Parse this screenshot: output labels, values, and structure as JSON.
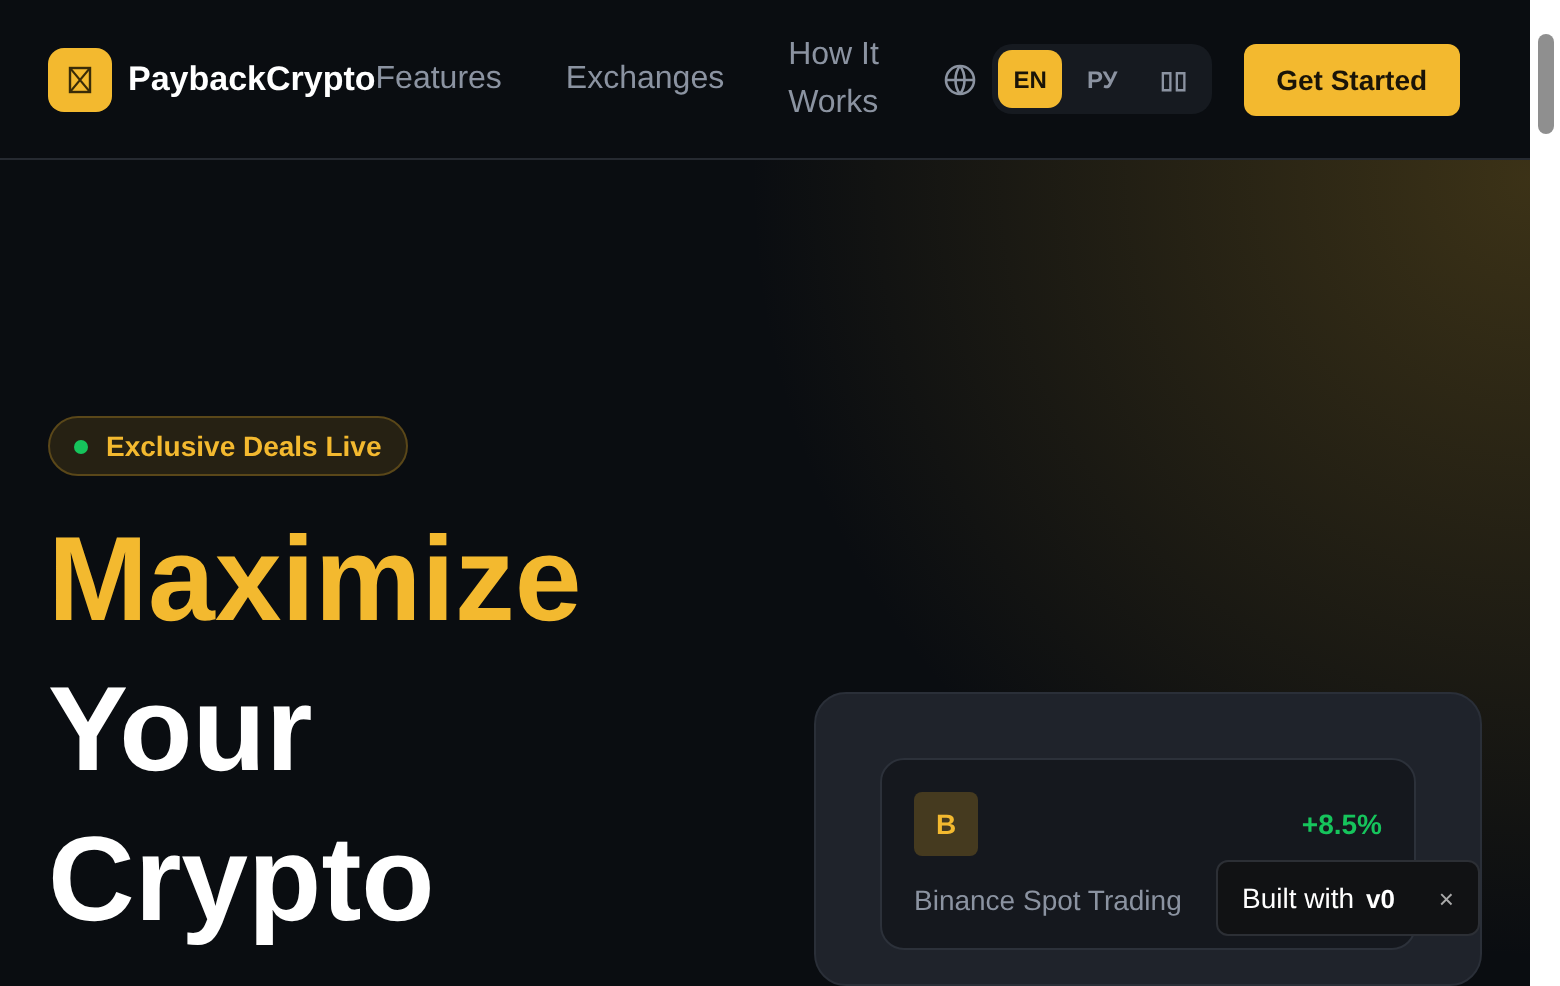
{
  "header": {
    "brand": "PaybackCrypto",
    "nav": [
      "Features",
      "Exchanges",
      "How It Works"
    ],
    "languages": [
      {
        "label": "EN",
        "selected": true
      },
      {
        "label": "РУ",
        "selected": false
      },
      {
        "label": "▯▯",
        "selected": false
      }
    ],
    "cta": "Get Started"
  },
  "hero": {
    "badge": "Exclusive Deals Live",
    "headline": [
      {
        "text": "Maximize",
        "accent": true
      },
      {
        "text": "Your",
        "accent": false
      },
      {
        "text": "Crypto",
        "accent": false
      }
    ]
  },
  "deal_card": {
    "logo_letter": "B",
    "change": "+8.5%",
    "name": "Binance Spot Trading"
  },
  "toast": {
    "text": "Built with",
    "logo": "v0",
    "close": "×"
  }
}
